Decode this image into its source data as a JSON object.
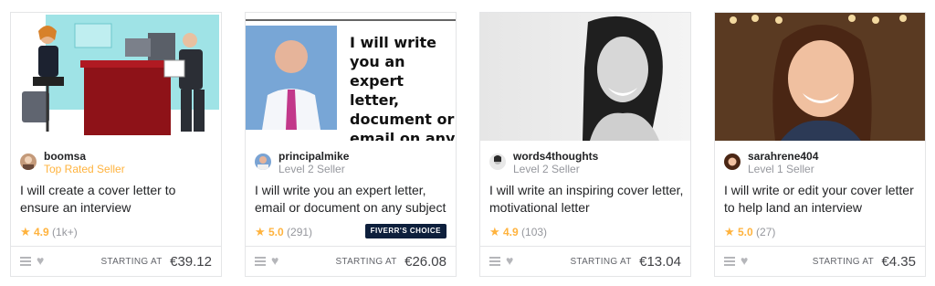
{
  "gigs": [
    {
      "seller_name": "boomsa",
      "seller_level": "Top Rated Seller",
      "title": "I will create a cover letter to ensure an interview",
      "rating": "4.9",
      "rating_count": "(1k+)",
      "price_label": "STARTING AT",
      "price": "€39.12",
      "thumbnail": "office-illustration"
    },
    {
      "seller_name": "principalmike",
      "seller_level": "Level 2 Seller",
      "title": "I will write you an expert letter, email or document on any subject",
      "rating": "5.0",
      "rating_count": "(291)",
      "badge": "FIVERR'S CHOICE",
      "price_label": "STARTING AT",
      "price": "€26.08",
      "thumbnail": "portrait-with-text",
      "thumbnail_text": "I will write you an expert letter, document or email on any subject"
    },
    {
      "seller_name": "words4thoughts",
      "seller_level": "Level 2 Seller",
      "title": "I will write an inspiring cover letter, motivational letter",
      "rating": "4.9",
      "rating_count": "(103)",
      "price_label": "STARTING AT",
      "price": "€13.04",
      "thumbnail": "bw-portrait"
    },
    {
      "seller_name": "sarahrene404",
      "seller_level": "Level 1 Seller",
      "title": "I will write or edit your cover letter to help land an interview",
      "rating": "5.0",
      "rating_count": "(27)",
      "price_label": "STARTING AT",
      "price": "€4.35",
      "thumbnail": "portrait-photo"
    }
  ],
  "icons": {
    "star": "star-icon",
    "menu": "list-icon",
    "heart": "heart-icon"
  },
  "colors": {
    "star": "#ffb33e",
    "top_rated": "#ffb33e",
    "muted": "#95979d",
    "badge_bg": "#0d1f3c",
    "border": "#e4e5e7"
  }
}
